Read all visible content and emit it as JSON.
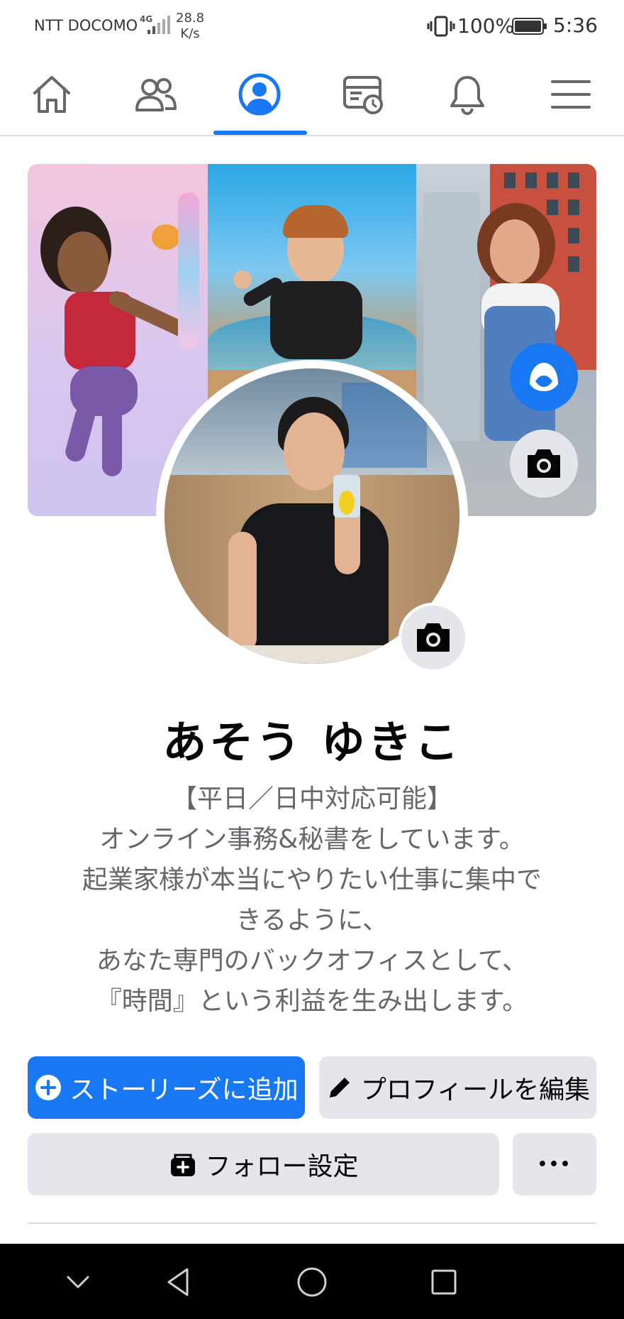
{
  "status_bar": {
    "carrier": "NTT DOCOMO",
    "network": "4G",
    "speed_value": "28.8",
    "speed_unit": "K/s",
    "battery": "100%",
    "time": "5:36"
  },
  "nav": {
    "tabs": [
      {
        "icon": "home-icon"
      },
      {
        "icon": "friends-icon"
      },
      {
        "icon": "profile-icon",
        "active": true
      },
      {
        "icon": "feeds-icon"
      },
      {
        "icon": "notifications-icon"
      },
      {
        "icon": "menu-icon"
      }
    ],
    "accent": "#1877f2"
  },
  "profile": {
    "name": "あそう ゆきこ",
    "bio_lines": [
      "【平日／日中対応可能】",
      "オンライン事務&秘書をしています。",
      "起業家様が本当にやりたい仕事に集中で",
      "きるように、",
      "あなた専門のバックオフィスとして、",
      "『時間』という利益を生み出します。"
    ]
  },
  "actions": {
    "add_story": "ストーリーズに追加",
    "edit_profile": "プロフィールを編集",
    "follow_settings": "フォロー設定",
    "more": "•••"
  },
  "colors": {
    "primary": "#1877f2",
    "secondary_button": "#e4e6eb",
    "text_muted": "#65676b"
  }
}
